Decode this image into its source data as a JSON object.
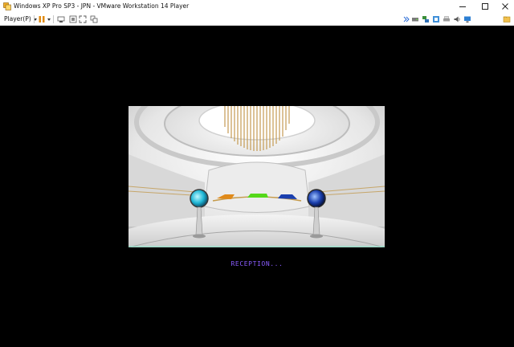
{
  "window": {
    "title": "Windows XP Pro SP3 - JPN - VMware Workstation 14 Player",
    "icon": "vmware-player-icon",
    "controls": [
      "minimize-icon",
      "maximize-icon",
      "close-icon"
    ]
  },
  "toolbar": {
    "player_menu_label": "Player(P)",
    "left_icons": [
      "pause-icon",
      "send-ctrl-alt-del-icon",
      "removable-devices-icon",
      "fullscreen-icon",
      "unity-icon"
    ],
    "right_icons": [
      "expand-arrow-icon",
      "hard-disk-icon",
      "network-icon",
      "usb-icon",
      "printer-icon",
      "sound-icon",
      "display-icon",
      "message-log-icon"
    ]
  },
  "guest": {
    "status_text": "RECEPTION..."
  },
  "colors": {
    "status_text": "#8a5cff",
    "guest_background": "#000000",
    "chrome_background": "#ffffff"
  }
}
